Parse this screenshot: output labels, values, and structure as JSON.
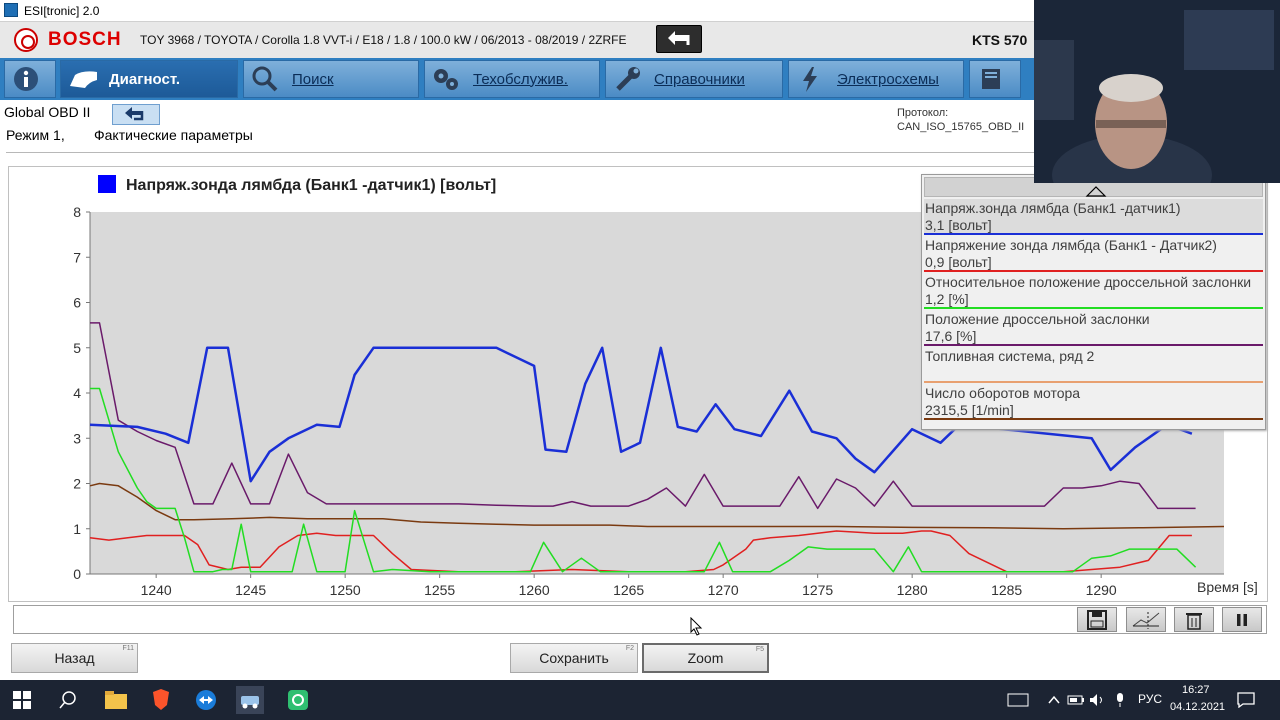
{
  "window": {
    "title": "ESI[tronic] 2.0"
  },
  "header": {
    "brand": "BOSCH",
    "vehicle": "TOY 3968 / TOYOTA / Corolla 1.8 VVT-i / E18 / 1.8 / 100.0 kW / 06/2013 - 08/2019 / 2ZRFE",
    "device": "KTS 570"
  },
  "nav": {
    "diag": "Диагност.",
    "search": "Поиск",
    "service": "Техобслужив.",
    "reference": "Справочники",
    "wiring": "Электросхемы"
  },
  "page": {
    "obd_title": "Global OBD II",
    "mode_label": "Режим 1,",
    "mode_name": "Фактические параметры",
    "protocol_label": "Протокол:",
    "protocol_value": "CAN_ISO_15765_OBD_II"
  },
  "legend": [
    {
      "name": "Напряж.зонда лямбда (Банк1 -датчик1)",
      "value": "3,1 [вольт]",
      "color": "#1a2fd6"
    },
    {
      "name": "Напряжение зонда лямбда (Банк1 - Датчик2)",
      "value": "0,9 [вольт]",
      "color": "#e02020"
    },
    {
      "name": "Относительное положение дроссельной заслонки",
      "value": "1,2 [%]",
      "color": "#22dd22"
    },
    {
      "name": "Положение дроссельной заслонки",
      "value": "17,6 [%]",
      "color": "#6a1a6a"
    },
    {
      "name": "Топливная система, ряд 2",
      "value": "",
      "color": "#e8a070"
    },
    {
      "name": "Число оборотов мотора",
      "value": "2315,5 [1/min]",
      "color": "#7a3a10"
    }
  ],
  "chart_data": {
    "type": "line",
    "title": "Напряж.зонда лямбда (Банк1 -датчик1) [вольт]",
    "title_color": "#0000ff",
    "xlabel": "Время [s]",
    "xlim": [
      1236.5,
      1296.5
    ],
    "ylim": [
      0,
      8
    ],
    "x_ticks": [
      "1240",
      "1245",
      "1250",
      "1255",
      "1260",
      "1265",
      "1270",
      "1275",
      "1280",
      "1285",
      "1290"
    ],
    "y_ticks": [
      "0",
      "1",
      "2",
      "3",
      "4",
      "5",
      "6",
      "7",
      "8"
    ],
    "grid": false,
    "series": [
      {
        "color": "#1a2fd6",
        "x": [
          1236.5,
          1239,
          1240.5,
          1241.7,
          1242.7,
          1243.8,
          1245,
          1246,
          1247,
          1248.5,
          1249.7,
          1250.5,
          1251.5,
          1252.7,
          1253.5,
          1255,
          1256,
          1258,
          1260,
          1260.6,
          1261.7,
          1262.7,
          1263.6,
          1264.6,
          1265.6,
          1266.7,
          1267.6,
          1268.6,
          1269.6,
          1270.6,
          1272,
          1273.5,
          1274.7,
          1276,
          1277,
          1278,
          1280,
          1281.5,
          1282.5,
          1289.5,
          1290.5,
          1291.8,
          1293.5,
          1294.8
        ],
        "values": [
          3.3,
          3.25,
          3.1,
          2.9,
          5.0,
          5.0,
          2.05,
          2.7,
          3.0,
          3.3,
          3.25,
          4.4,
          5.0,
          5.0,
          5.0,
          5.0,
          5.0,
          5.0,
          4.6,
          2.75,
          2.7,
          4.2,
          5.0,
          2.7,
          2.9,
          5.0,
          3.25,
          3.15,
          3.75,
          3.2,
          3.05,
          4.05,
          3.15,
          3.0,
          2.55,
          2.25,
          3.2,
          2.9,
          3.3,
          3.0,
          2.3,
          2.8,
          3.3,
          3.1
        ]
      },
      {
        "color": "#6a1a6a",
        "x": [
          1236.5,
          1237,
          1238,
          1239,
          1240,
          1241,
          1242,
          1243,
          1244,
          1245,
          1246,
          1247,
          1248,
          1249,
          1250,
          1251,
          1252,
          1254,
          1256,
          1258,
          1260,
          1261,
          1262,
          1263,
          1264,
          1265,
          1266,
          1267,
          1268,
          1269,
          1270,
          1271,
          1272,
          1273,
          1274,
          1275,
          1276,
          1277,
          1278,
          1279,
          1280,
          1281,
          1282,
          1284,
          1286,
          1287,
          1288,
          1289,
          1290,
          1291,
          1292,
          1293,
          1294,
          1295
        ],
        "values": [
          5.55,
          5.55,
          3.4,
          3.15,
          2.95,
          2.8,
          1.55,
          1.55,
          2.45,
          1.55,
          1.55,
          2.65,
          1.8,
          1.55,
          1.55,
          1.55,
          1.55,
          1.55,
          1.55,
          1.52,
          1.5,
          1.5,
          1.6,
          1.5,
          1.5,
          1.5,
          1.65,
          1.9,
          1.5,
          2.2,
          1.5,
          1.5,
          1.5,
          1.5,
          2.15,
          1.45,
          2.1,
          1.9,
          1.5,
          2.05,
          1.5,
          1.5,
          1.5,
          1.5,
          1.5,
          1.5,
          1.9,
          1.9,
          1.95,
          2.05,
          2.0,
          1.45,
          1.45,
          1.45
        ]
      },
      {
        "color": "#7a3a10",
        "x": [
          1236.5,
          1237,
          1238,
          1239,
          1240,
          1241,
          1242,
          1244,
          1246,
          1248,
          1250,
          1252,
          1254,
          1256,
          1258,
          1260,
          1262,
          1264,
          1266,
          1268,
          1270,
          1272,
          1276,
          1280,
          1284,
          1288,
          1292,
          1296.5
        ],
        "values": [
          1.95,
          2.0,
          1.95,
          1.7,
          1.4,
          1.2,
          1.2,
          1.22,
          1.25,
          1.22,
          1.22,
          1.22,
          1.15,
          1.12,
          1.1,
          1.08,
          1.08,
          1.08,
          1.05,
          1.05,
          1.05,
          1.05,
          1.05,
          1.03,
          1.02,
          1.0,
          1.02,
          1.05
        ]
      },
      {
        "color": "#e02020",
        "x": [
          1236.5,
          1237.5,
          1238.5,
          1239.5,
          1240.5,
          1241.5,
          1242.2,
          1242.8,
          1243.8,
          1244.5,
          1245.5,
          1246.5,
          1247.5,
          1248.5,
          1249.5,
          1250.5,
          1251.5,
          1252.5,
          1253.5,
          1256,
          1259,
          1262,
          1265,
          1268,
          1269.5,
          1270,
          1271.2,
          1271.6,
          1272.5,
          1274,
          1276,
          1278,
          1279.5,
          1280.5,
          1281,
          1282,
          1283,
          1285,
          1287,
          1288,
          1289.5,
          1291,
          1292.5,
          1293.6,
          1294.8
        ],
        "values": [
          0.8,
          0.75,
          0.8,
          0.85,
          0.85,
          0.85,
          0.65,
          0.2,
          0.1,
          0.15,
          0.15,
          0.6,
          0.85,
          0.9,
          0.85,
          0.85,
          0.85,
          0.45,
          0.1,
          0.05,
          0.05,
          0.1,
          0.05,
          0.05,
          0.1,
          0.2,
          0.55,
          0.75,
          0.8,
          0.85,
          0.95,
          0.9,
          0.9,
          0.95,
          0.95,
          0.85,
          0.45,
          0.05,
          0.05,
          0.05,
          0.1,
          0.15,
          0.3,
          0.85,
          0.85
        ]
      },
      {
        "color": "#22dd22",
        "x": [
          1236.5,
          1237,
          1238,
          1239,
          1239.5,
          1240,
          1240.5,
          1241,
          1241.5,
          1242,
          1243,
          1243.5,
          1244,
          1244.5,
          1245,
          1245.8,
          1247.2,
          1247.8,
          1248.5,
          1249.5,
          1250,
          1250.5,
          1251.5,
          1252.5,
          1254.5,
          1256.5,
          1258.5,
          1259.8,
          1260.5,
          1261.5,
          1262.5,
          1263.5,
          1264.5,
          1265.5,
          1267.5,
          1269,
          1269.8,
          1270.5,
          1271.5,
          1272.5,
          1273.5,
          1274.5,
          1275.5,
          1276.5,
          1278,
          1279,
          1279.8,
          1280.5,
          1281.5,
          1283,
          1285,
          1287,
          1288.5,
          1289.5,
          1290.5,
          1291.5,
          1293,
          1294,
          1295
        ],
        "values": [
          4.1,
          4.1,
          2.7,
          1.9,
          1.6,
          1.45,
          1.45,
          1.45,
          0.8,
          0.05,
          0.05,
          0.1,
          0.1,
          1.1,
          0.05,
          0.05,
          0.05,
          1.1,
          0.05,
          0.05,
          0.05,
          1.4,
          0.05,
          0.1,
          0.05,
          0.05,
          0.05,
          0.05,
          0.7,
          0.05,
          0.35,
          0.05,
          0.05,
          0.05,
          0.05,
          0.05,
          0.7,
          0.05,
          0.05,
          0.05,
          0.3,
          0.6,
          0.55,
          0.55,
          0.55,
          0.05,
          0.6,
          0.05,
          0.05,
          0.05,
          0.05,
          0.05,
          0.05,
          0.35,
          0.4,
          0.55,
          0.55,
          0.55,
          0.15
        ]
      }
    ]
  },
  "footer": {
    "back": "Назад",
    "back_key": "F11",
    "save": "Сохранить",
    "save_key": "F2",
    "zoom": "Zoom",
    "zoom_key": "F5"
  },
  "taskbar": {
    "lang": "РУС",
    "time": "16:27",
    "date": "04.12.2021"
  }
}
